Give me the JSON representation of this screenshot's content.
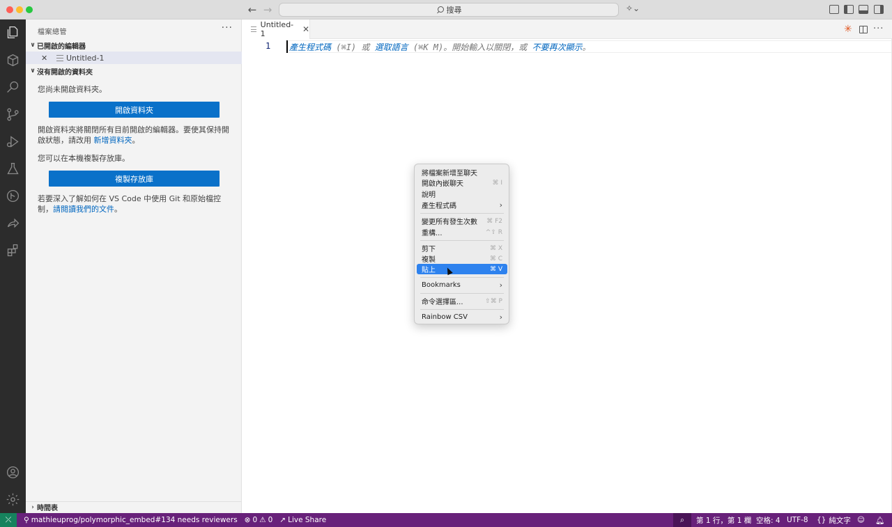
{
  "titlebar": {
    "search_label": "搜尋",
    "icons": [
      "back-arrow-icon",
      "forward-arrow-icon",
      "search-icon",
      "copilot-icon",
      "customize-layout-icon",
      "toggle-primary-sidebar-icon",
      "toggle-panel-icon",
      "toggle-secondary-sidebar-icon"
    ]
  },
  "activity_bar": {
    "icons": [
      "explorer-icon",
      "extensions-cube-icon",
      "search-icon",
      "source-control-icon",
      "run-debug-icon",
      "testing-flask-icon",
      "git-graph-icon",
      "live-share-icon",
      "extensions-icon",
      "account-icon",
      "settings-gear-icon"
    ]
  },
  "sidebar": {
    "title": "檔案總管",
    "more": "···",
    "open_editors": {
      "label": "已開啟的編輯器",
      "items": [
        {
          "name": "Untitled-1"
        }
      ]
    },
    "no_folder": {
      "label": "沒有開啟的資料夾",
      "message": "您尚未開啟資料夾。",
      "open_folder_button": "開啟資料夾",
      "note_prefix": "開啟資料夾將關閉所有目前開啟的編輯器。要使其保持開啟狀態，請改用 ",
      "note_link": "新增資料夾",
      "note_suffix": "。",
      "clone_message": "您可以在本機複製存放庫。",
      "clone_button": "複製存放庫",
      "git_prefix": "若要深入了解如何在 VS Code 中使用 Git 和原始檔控制，",
      "git_link": "請閱讀我們的文件",
      "git_suffix": "。"
    },
    "timeline": {
      "label": "時間表"
    }
  },
  "editor": {
    "tab_label": "Untitled-1",
    "line_number": "1",
    "hint": {
      "generate": "產生程式碼",
      "generate_sc": "(⌘I)",
      "or1": "或",
      "select_lang": "選取語言",
      "select_lang_sc": "(⌘K M)。開始輸入以關閉，或",
      "dont_show": "不要再次顯示",
      "end": "。"
    }
  },
  "context_menu": {
    "items": [
      {
        "label": "將檔案新增至聊天",
        "shortcut": ""
      },
      {
        "label": "開啟內嵌聊天",
        "shortcut": "⌘ I"
      },
      {
        "label": "說明",
        "shortcut": ""
      },
      {
        "label": "產生程式碼",
        "shortcut": "",
        "submenu": true
      },
      {
        "label": "變更所有發生次數",
        "shortcut": "⌘ F2"
      },
      {
        "label": "重構...",
        "shortcut": "^⇧ R"
      },
      {
        "label": "剪下",
        "shortcut": "⌘ X"
      },
      {
        "label": "複製",
        "shortcut": "⌘ C"
      },
      {
        "label": "貼上",
        "shortcut": "⌘ V",
        "selected": true
      },
      {
        "label": "Bookmarks",
        "shortcut": "",
        "submenu": true
      },
      {
        "label": "命令選擇區...",
        "shortcut": "⇧⌘ P"
      },
      {
        "label": "Rainbow CSV",
        "shortcut": "",
        "submenu": true
      }
    ],
    "submenu_arrow": "›"
  },
  "statusbar": {
    "remote_icon": "remote-icon",
    "branch_text": "mathieuprog/polymorphic_embed#134 needs reviewers",
    "errors": "0",
    "warnings": "0",
    "live_share": "Live Share",
    "position": "第 1 行，第 1 欄",
    "spaces": "空格: 4",
    "encoding": "UTF-8",
    "language": "純文字",
    "language_prefix": "{}",
    "colors": {
      "background": "#68217a",
      "remote": "#16825d"
    }
  }
}
